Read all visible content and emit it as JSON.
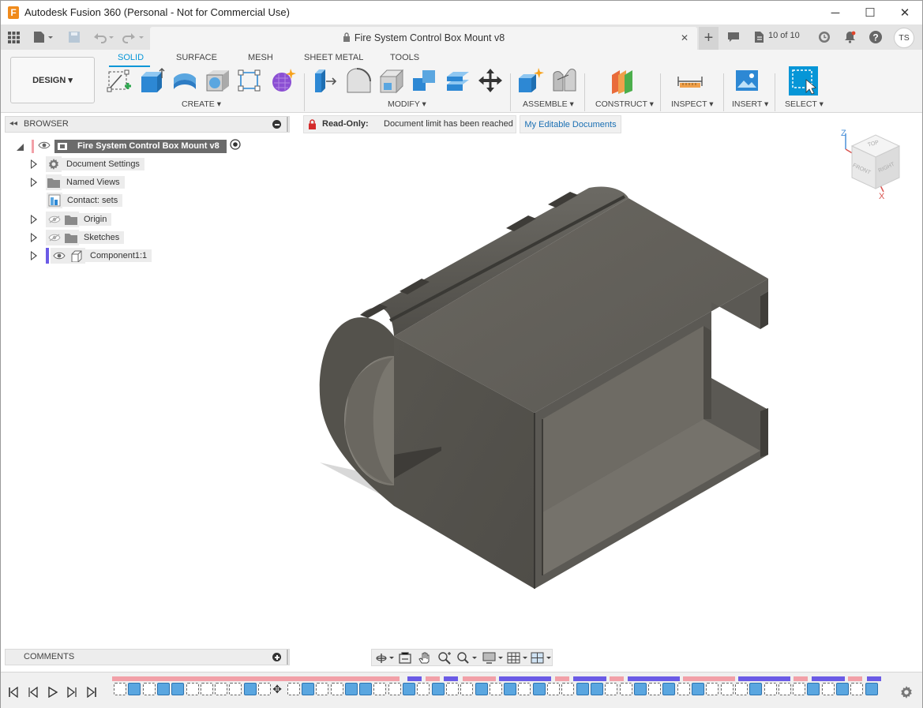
{
  "window": {
    "app_title": "Autodesk Fusion 360 (Personal - Not for Commercial Use)",
    "minimize_glyph": "─",
    "maximize_glyph": "☐",
    "close_glyph": "✕"
  },
  "doc_tab": {
    "title": "Fire System Control Box Mount v8",
    "close_glyph": "✕",
    "version_count": "10 of 10",
    "user_initials": "TS"
  },
  "ribbon": {
    "workspace": "DESIGN ▾",
    "tabs": [
      "SOLID",
      "SURFACE",
      "MESH",
      "SHEET METAL",
      "TOOLS"
    ],
    "active_tab": "SOLID",
    "groups": {
      "create": "CREATE ▾",
      "modify": "MODIFY ▾",
      "assemble": "ASSEMBLE ▾",
      "construct": "CONSTRUCT ▾",
      "inspect": "INSPECT ▾",
      "insert": "INSERT ▾",
      "select": "SELECT ▾"
    }
  },
  "browser": {
    "title": "BROWSER",
    "root": "Fire System Control Box Mount v8",
    "items": [
      "Document Settings",
      "Named Views",
      "Contact: sets",
      "Origin",
      "Sketches",
      "Component1:1"
    ]
  },
  "readonly": {
    "label": "Read-Only:",
    "message": "Document limit has been reached",
    "link": "My Editable Documents"
  },
  "viewcube": {
    "top": "TOP",
    "front": "FRONT",
    "right": "RIGHT",
    "axis_z": "Z",
    "axis_x": "X"
  },
  "comments": {
    "title": "COMMENTS"
  },
  "colors": {
    "accent": "#0696d7",
    "model_grey": "#5c5a55",
    "readonly_lock": "#d42a2a",
    "timeline_pink": "#f2a0a8",
    "timeline_purple": "#6b5be6"
  }
}
